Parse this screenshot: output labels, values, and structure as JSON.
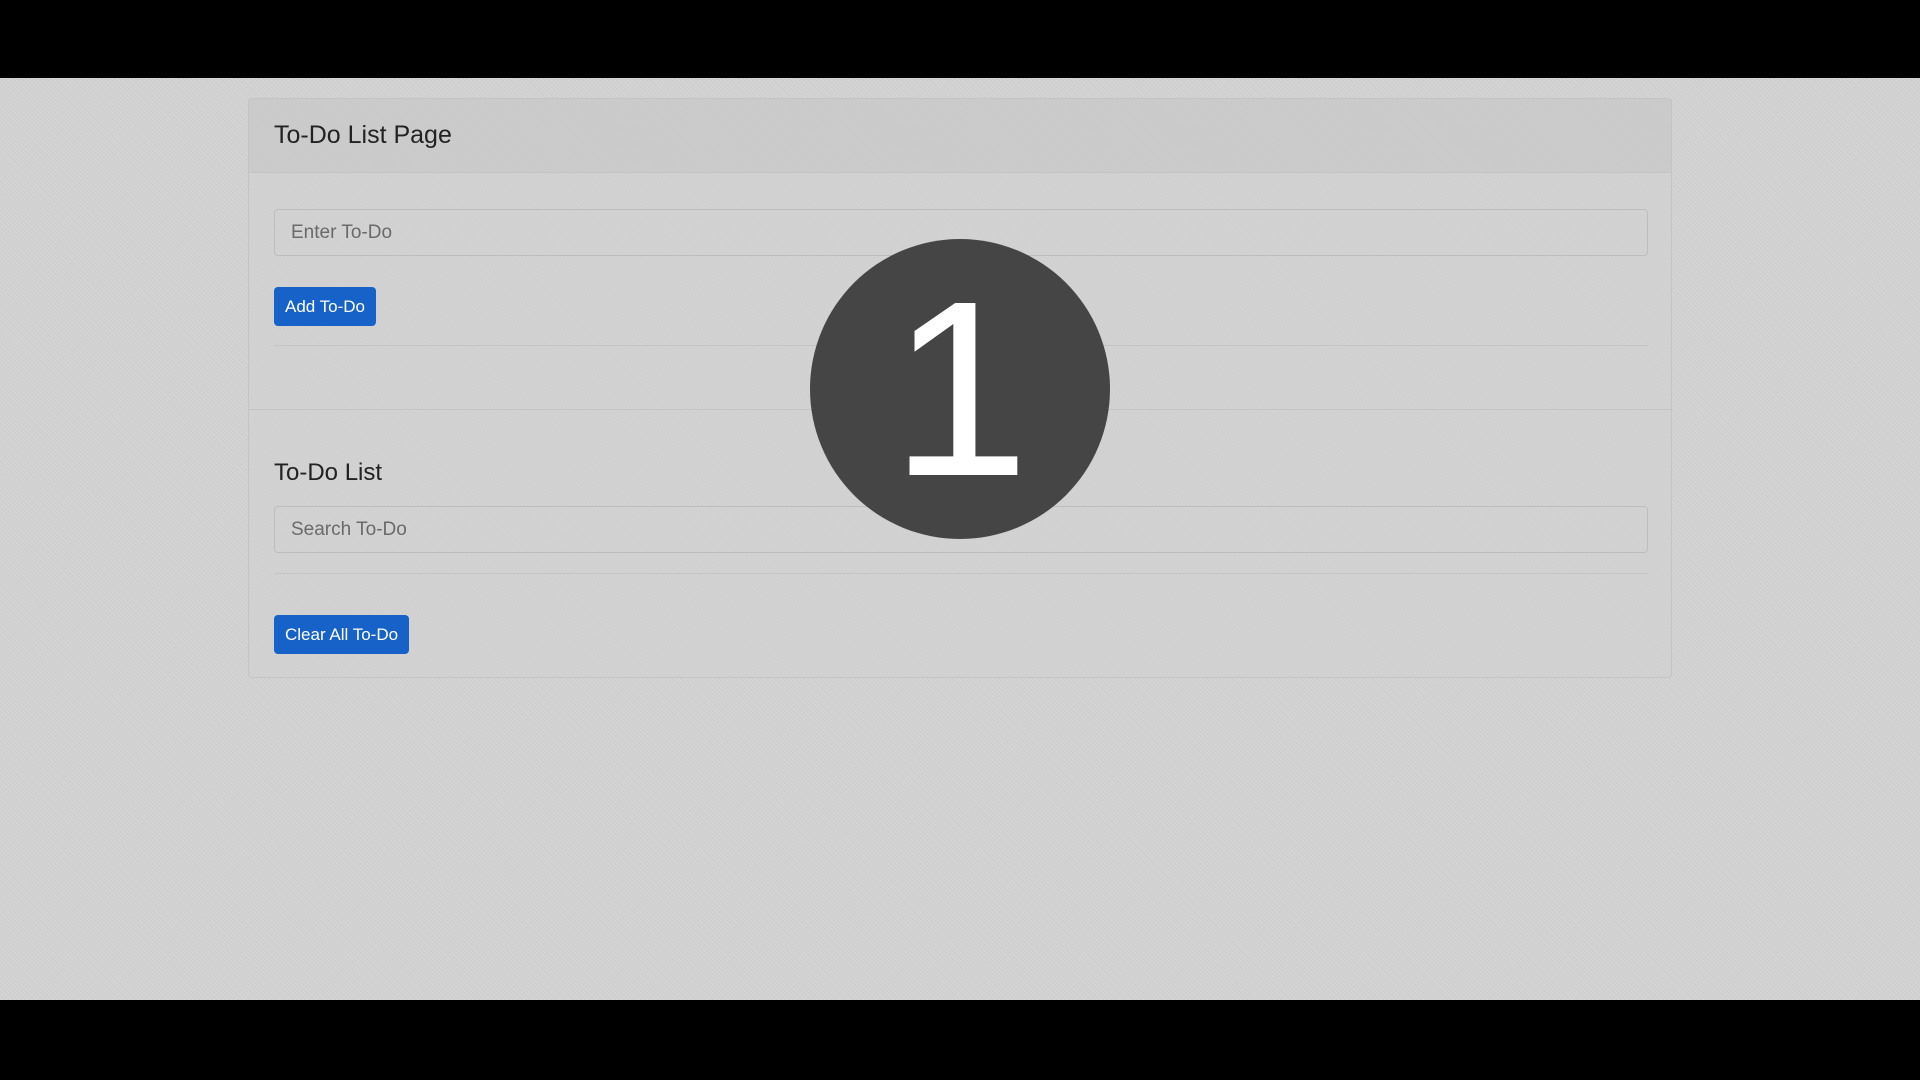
{
  "page": {
    "header_title": "To-Do List Page"
  },
  "add_form": {
    "input_placeholder": "Enter To-Do",
    "input_value": "",
    "add_button_label": "Add To-Do"
  },
  "list_section": {
    "title": "To-Do List",
    "search_placeholder": "Search To-Do",
    "search_value": "",
    "clear_button_label": "Clear All To-Do"
  },
  "overlay": {
    "step_number": "1"
  },
  "colors": {
    "button_primary": "#1762c9",
    "page_background": "#d3d3d3",
    "overlay_badge": "#454545"
  }
}
